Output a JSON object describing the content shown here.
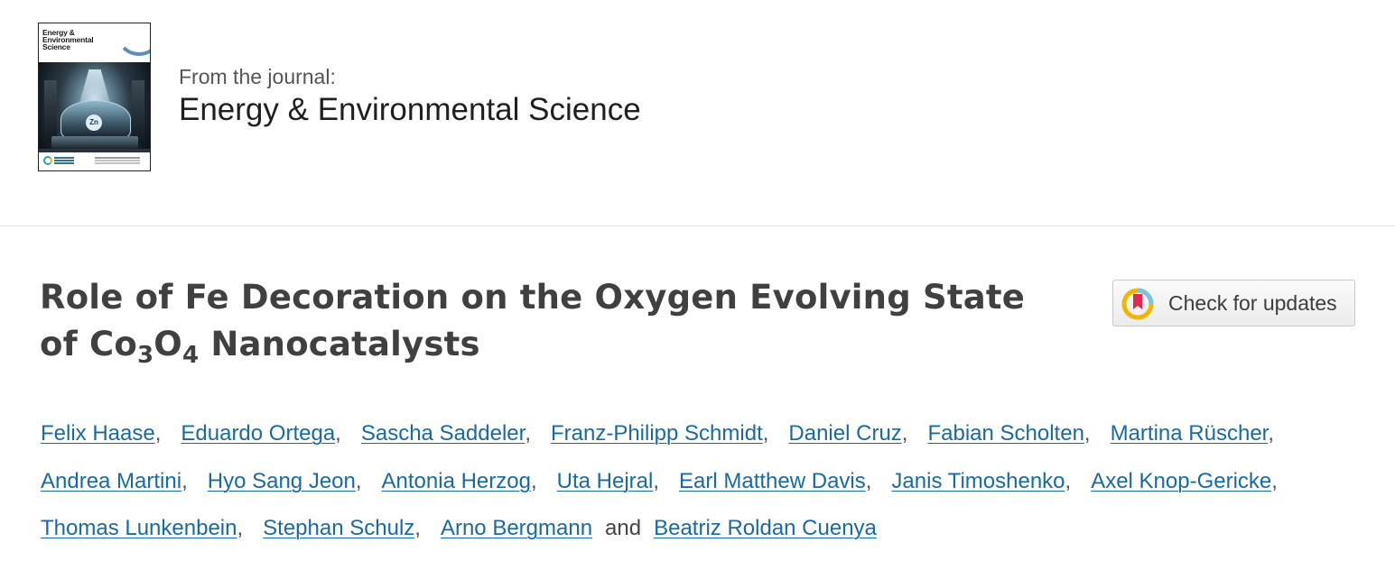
{
  "journal": {
    "cover_title_lines": [
      "Energy &",
      "Environmental",
      "Science"
    ],
    "cover_badge_text": "Zn",
    "from_label": "From the journal:",
    "name": "Energy & Environmental Science"
  },
  "article": {
    "title_line1": "Role of Fe Decoration on the Oxygen Evolving State",
    "title_of": "of Co",
    "title_sub1": "3",
    "title_o": "O",
    "title_sub2": "4",
    "title_rest": " Nanocatalysts"
  },
  "check_updates": {
    "label": "Check for updates",
    "icon": "crossmark-icon"
  },
  "authors": {
    "separator": ",",
    "conjunction": "and",
    "line1": [
      "Felix Haase",
      "Eduardo Ortega",
      "Sascha Saddeler",
      "Franz-Philipp Schmidt",
      "Daniel Cruz",
      "Fabian Scholten",
      "Martina Rüscher"
    ],
    "line2": [
      "Andrea Martini",
      "Hyo Sang Jeon",
      "Antonia Herzog",
      "Uta Hejral",
      "Earl Matthew Davis",
      "Janis Timoshenko",
      "Axel Knop-Gericke"
    ],
    "line3": [
      "Thomas Lunkenbein",
      "Stephan Schulz",
      "Arno Bergmann"
    ],
    "last": "Beatriz Roldan Cuenya"
  },
  "colors": {
    "link": "#1a6aa2",
    "title": "#404040",
    "divider": "#e3e3e3"
  }
}
